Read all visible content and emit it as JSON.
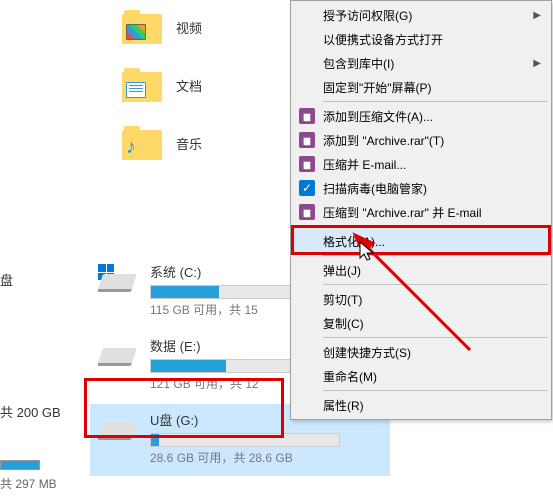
{
  "folders": [
    {
      "label": "视频",
      "icon": "video"
    },
    {
      "label": "文档",
      "icon": "doc"
    },
    {
      "label": "音乐",
      "icon": "music"
    }
  ],
  "sidebar": {
    "disk_label": "盘",
    "size_label": "共 200 GB"
  },
  "drives": [
    {
      "name": "系统 (C:)",
      "status": "115 GB 可用，共 15",
      "fill_pct": 36,
      "win": true
    },
    {
      "name": "数据 (E:)",
      "status": "121 GB 可用，共 12",
      "fill_pct": 40,
      "win": false
    },
    {
      "name": "U盘 (G:)",
      "status_full": "28.6 GB 可用，共 28.6 GB",
      "fill_pct": 4,
      "win": false,
      "selected": true
    }
  ],
  "bottom": {
    "size": "共 297 MB"
  },
  "menu": {
    "items": [
      {
        "label": "授予访问权限(G)",
        "arrow": true
      },
      {
        "label": "以便携式设备方式打开"
      },
      {
        "label": "包含到库中(I)",
        "arrow": true
      },
      {
        "label": "固定到\"开始\"屏幕(P)"
      },
      {
        "sep": true
      },
      {
        "label": "添加到压缩文件(A)...",
        "icon": "rar"
      },
      {
        "label": "添加到 \"Archive.rar\"(T)",
        "icon": "rar"
      },
      {
        "label": "压缩并 E-mail...",
        "icon": "rar"
      },
      {
        "label": "扫描病毒(电脑管家)",
        "icon": "shield"
      },
      {
        "label": "压缩到 \"Archive.rar\" 并 E-mail",
        "icon": "rar"
      },
      {
        "sep": true
      },
      {
        "label": "格式化(A)...",
        "highlight": true,
        "annot": true
      },
      {
        "sep": true
      },
      {
        "label": "弹出(J)"
      },
      {
        "sep": true
      },
      {
        "label": "剪切(T)"
      },
      {
        "label": "复制(C)"
      },
      {
        "sep": true
      },
      {
        "label": "创建快捷方式(S)"
      },
      {
        "label": "重命名(M)"
      },
      {
        "sep": true
      },
      {
        "label": "属性(R)"
      }
    ]
  }
}
